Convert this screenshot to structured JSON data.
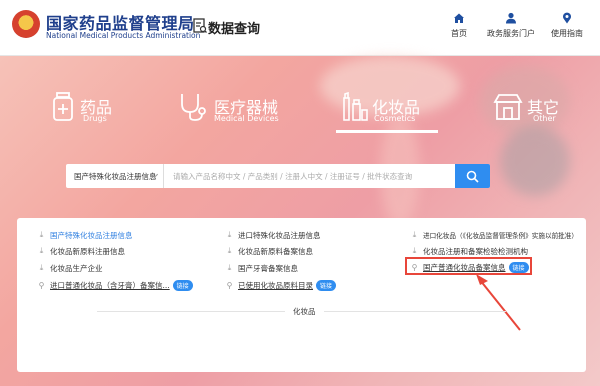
{
  "header": {
    "org_cn": "国家药品监督管理局",
    "org_en": "National Medical Products Administration",
    "section_title": "数据查询",
    "nav": [
      {
        "label": "首页",
        "icon": "home-icon"
      },
      {
        "label": "政务服务门户",
        "icon": "user-icon"
      },
      {
        "label": "使用指南",
        "icon": "pin-icon"
      }
    ]
  },
  "categories": [
    {
      "cn": "药品",
      "en": "Drugs",
      "icon": "pill-bottle-icon"
    },
    {
      "cn": "医疗器械",
      "en": "Medical Devices",
      "icon": "stethoscope-icon"
    },
    {
      "cn": "化妆品",
      "en": "Cosmetics",
      "icon": "cosmetics-icon",
      "active": true
    },
    {
      "cn": "其它",
      "en": "Other",
      "icon": "shop-icon"
    }
  ],
  "search": {
    "selected_type": "国产特殊化妆品注册信息",
    "placeholder": "请输入产品名称中文 / 产品类别 / 注册人中文 / 注册证号 / 批件状态查询"
  },
  "panel": {
    "items": [
      {
        "text": "国产特殊化妆品注册信息",
        "icon": "⤓",
        "style": "blue"
      },
      {
        "text": "化妆品新原料注册信息",
        "icon": "⤓"
      },
      {
        "text": "化妆品生产企业",
        "icon": "⤓"
      },
      {
        "text": "进口普通化妆品（含牙膏）备案信...",
        "icon": "⚲",
        "badge": "链接",
        "style": "ul"
      },
      {
        "text": "进口特殊化妆品注册信息",
        "icon": "⤓"
      },
      {
        "text": "化妆品新原料备案信息",
        "icon": "⤓"
      },
      {
        "text": "国产牙膏备案信息",
        "icon": "⤓"
      },
      {
        "text": "已使用化妆品原料目录",
        "icon": "⚲",
        "badge": "链接",
        "style": "ul"
      },
      {
        "text": "进口化妆品（《化妆品监督管理条例》实施以前批准）",
        "icon": "⤓"
      },
      {
        "text": "化妆品注册和备案检验检测机构",
        "icon": "⤓"
      },
      {
        "text": "国产普通化妆品备案信息",
        "icon": "⚲",
        "badge": "链接",
        "style": "ul"
      }
    ],
    "divider_label": "化妆品"
  },
  "colors": {
    "brand_blue": "#1f3f8c",
    "accent": "#2f8df0",
    "highlight": "#e8463a"
  }
}
